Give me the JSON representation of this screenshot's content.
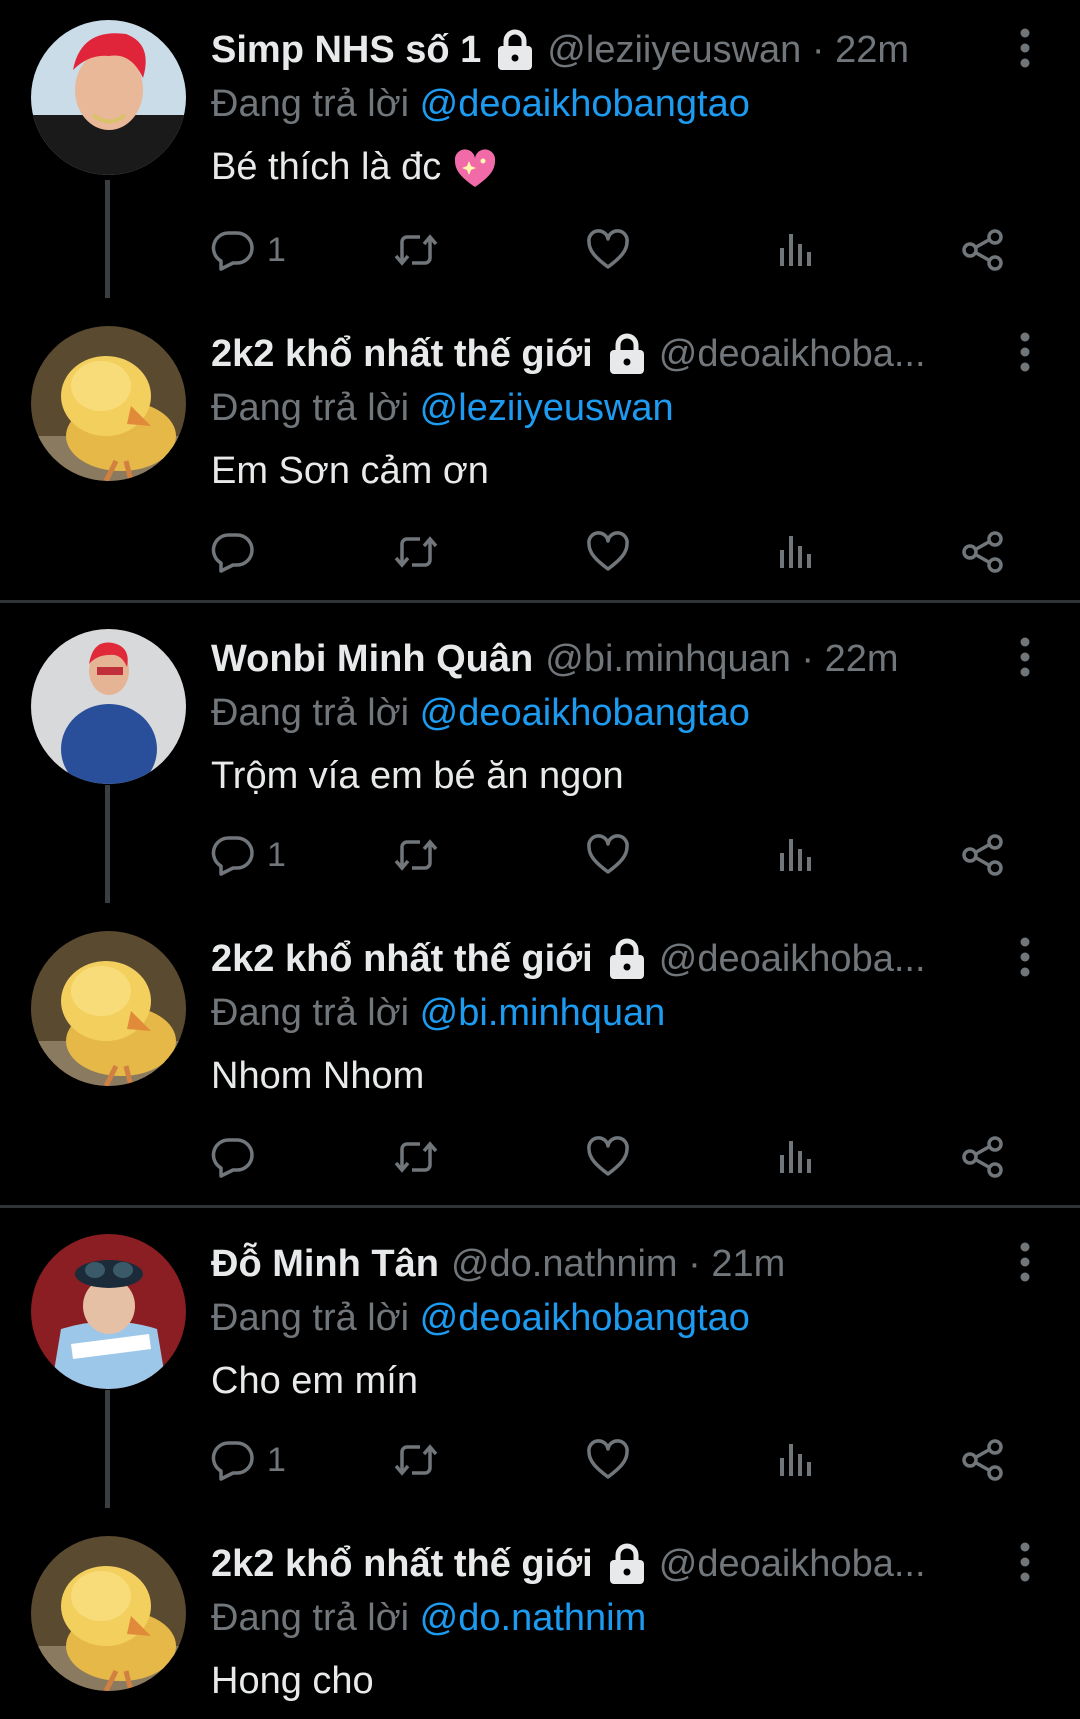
{
  "reply_prefix": "Đang trả lời",
  "colors": {
    "background": "#000000",
    "text": "#e7e9ea",
    "muted": "#71767b",
    "mention": "#1d9bf0",
    "divider": "#2f3336"
  },
  "tweets": [
    {
      "name": "Simp NHS số 1",
      "protected": true,
      "handle": "@leziiyeuswan · 22m",
      "replying_to": "@deoaikhobangtao",
      "text": "Bé thích là đc",
      "emoji": "sparkling-heart",
      "reply_count": "1"
    },
    {
      "name": "2k2 khổ nhất thế giới",
      "protected": true,
      "handle": "@deoaikhoba...",
      "replying_to": "@leziiyeuswan",
      "text": "Em Sơn cảm ơn",
      "reply_count": ""
    },
    {
      "name": "Wonbi Minh Quân",
      "protected": false,
      "handle": "@bi.minhquan · 22m",
      "replying_to": "@deoaikhobangtao",
      "text": "Trộm vía em bé ăn ngon",
      "reply_count": "1"
    },
    {
      "name": "2k2 khổ nhất thế giới",
      "protected": true,
      "handle": "@deoaikhoba...",
      "replying_to": "@bi.minhquan",
      "text": "Nhom Nhom",
      "reply_count": ""
    },
    {
      "name": "Đỗ Minh Tân",
      "protected": false,
      "handle": "@do.nathnim · 21m",
      "replying_to": "@deoaikhobangtao",
      "text": "Cho em mín",
      "reply_count": "1"
    },
    {
      "name": "2k2 khổ nhất thế giới",
      "protected": true,
      "handle": "@deoaikhoba...",
      "replying_to": "@do.nathnim",
      "text": "Hong cho"
    }
  ]
}
